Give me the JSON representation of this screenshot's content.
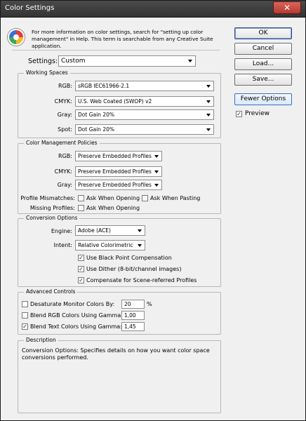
{
  "window": {
    "title": "Color Settings",
    "close_glyph": "✕",
    "info_text": "For more information on color settings, search for \"setting up color management\" in Help. This term is searchable from any Creative Suite application.",
    "info_icon": "color-wheel-icon"
  },
  "buttons": {
    "ok": "OK",
    "cancel": "Cancel",
    "load": "Load...",
    "save": "Save...",
    "fewer_options": "Fewer Options"
  },
  "preview": {
    "label": "Preview",
    "checked": "✓"
  },
  "settings": {
    "label": "Settings:",
    "value": "Custom"
  },
  "working_spaces": {
    "title": "Working Spaces",
    "rgb_label": "RGB:",
    "rgb_value": "sRGB IEC61966-2.1",
    "cmyk_label": "CMYK:",
    "cmyk_value": "U.S. Web Coated (SWOP) v2",
    "gray_label": "Gray:",
    "gray_value": "Dot Gain 20%",
    "spot_label": "Spot:",
    "spot_value": "Dot Gain 20%"
  },
  "policies": {
    "title": "Color Management Policies",
    "rgb_label": "RGB:",
    "rgb_value": "Preserve Embedded Profiles",
    "cmyk_label": "CMYK:",
    "cmyk_value": "Preserve Embedded Profiles",
    "gray_label": "Gray:",
    "gray_value": "Preserve Embedded Profiles",
    "mismatch_label": "Profile Mismatches:",
    "ask_opening": "Ask When Opening",
    "ask_pasting": "Ask When Pasting",
    "missing_label": "Missing Profiles:",
    "missing_ask_opening": "Ask When Opening"
  },
  "conversion": {
    "title": "Conversion Options",
    "engine_label": "Engine:",
    "engine_value": "Adobe (ACE)",
    "intent_label": "Intent:",
    "intent_value": "Relative Colorimetric",
    "bpc": "Use Black Point Compensation",
    "dither": "Use Dither (8-bit/channel images)",
    "compensate": "Compensate for Scene-referred Profiles",
    "check_glyph": "✓"
  },
  "advanced": {
    "title": "Advanced Controls",
    "desaturate_label": "Desaturate Monitor Colors By:",
    "desaturate_value": "20",
    "desaturate_unit": "%",
    "blend_rgb_label": "Blend RGB Colors Using Gamma:",
    "blend_rgb_value": "1,00",
    "blend_text_label": "Blend Text Colors Using Gamma:",
    "blend_text_value": "1,45",
    "check_glyph": "✓"
  },
  "description": {
    "title": "Description",
    "text": "Conversion Options: Specifies details on how you want color space conversions performed."
  }
}
